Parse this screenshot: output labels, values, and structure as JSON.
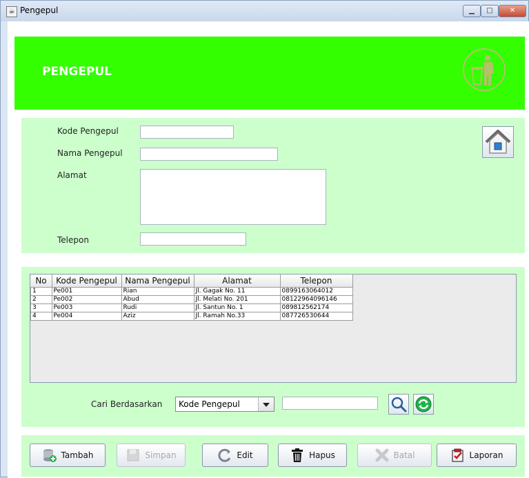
{
  "window": {
    "title": "Pengepul"
  },
  "header": {
    "title": "PENGEPUL"
  },
  "form": {
    "kode_label": "Kode Pengepul",
    "kode_value": "",
    "nama_label": "Nama Pengepul",
    "nama_value": "",
    "alamat_label": "Alamat",
    "alamat_value": "",
    "telepon_label": "Telepon",
    "telepon_value": ""
  },
  "table": {
    "columns": [
      "No",
      "Kode Pengepul",
      "Nama Pengepul",
      "Alamat",
      "Telepon"
    ],
    "rows": [
      [
        "1",
        "Pe001",
        "Rian",
        "Jl. Gagak No. 11",
        "0899163064012"
      ],
      [
        "2",
        "Pe002",
        "Abud",
        "Jl. Melati No. 201",
        "08122964096146"
      ],
      [
        "3",
        "Pe003",
        "Rudi",
        "Jl. Santun No. 1",
        "089812562174"
      ],
      [
        "4",
        "Pe004",
        "Aziz",
        "Jl. Ramah No.33",
        "087726530644"
      ]
    ]
  },
  "search": {
    "label": "Cari Berdasarkan",
    "selected": "Kode Pengepul",
    "value": ""
  },
  "buttons": {
    "tambah": "Tambah",
    "simpan": "Simpan",
    "edit": "Edit",
    "hapus": "Hapus",
    "batal": "Batal",
    "laporan": "Laporan"
  },
  "colors": {
    "banner": "#33ff00",
    "panel": "#ccffcc"
  }
}
